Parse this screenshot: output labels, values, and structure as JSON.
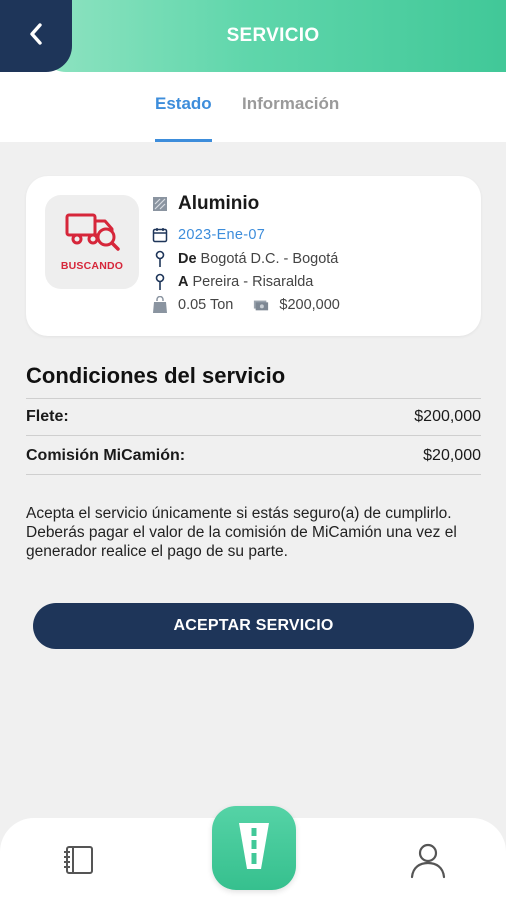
{
  "header": {
    "title": "SERVICIO",
    "back_icon": "chevron-left-icon"
  },
  "tabs": [
    {
      "label": "Estado",
      "active": true
    },
    {
      "label": "Información",
      "active": false
    }
  ],
  "service": {
    "status_label": "BUSCANDO",
    "cargo": "Aluminio",
    "date": "2023-Ene-07",
    "from_prefix": "De",
    "from": "Bogotá D.C. - Bogotá",
    "to_prefix": "A",
    "to": "Pereira - Risaralda",
    "weight": "0.05 Ton",
    "price": "$200,000"
  },
  "conditions": {
    "title": "Condiciones del servicio",
    "rows": [
      {
        "label": "Flete:",
        "value": "$200,000"
      },
      {
        "label": "Comisión MiCamión:",
        "value": "$20,000"
      }
    ],
    "notice": "Acepta el servicio únicamente si estás seguro(a) de cumplirlo. Deberás pagar el valor de la comisión de MiCamión una vez el generador realice el pago de su parte."
  },
  "actions": {
    "accept_label": "ACEPTAR SERVICIO"
  },
  "colors": {
    "navy": "#1e3559",
    "green": "#41c898",
    "blue": "#3d8ddb",
    "red": "#d6263a"
  }
}
